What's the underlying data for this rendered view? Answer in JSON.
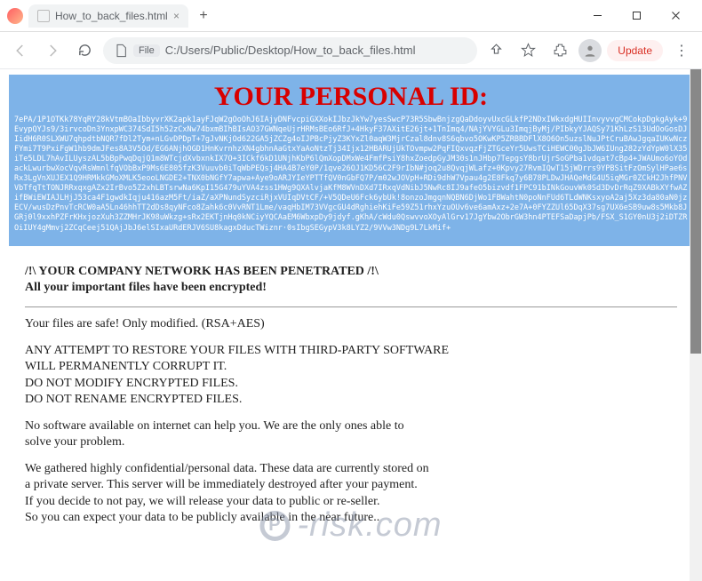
{
  "window": {
    "tab_title": "How_to_back_files.html",
    "new_tab_glyph": "+"
  },
  "toolbar": {
    "file_chip": "File",
    "url": "C:/Users/Public/Desktop/How_to_back_files.html",
    "update_label": "Update"
  },
  "ransom": {
    "heading": "YOUR PERSONAL ID:",
    "id_blob": "7ePA/1P1OTKk78YqRY28kVtmBOaIbbyvrXK2apk1ayFJqW2gOoOhJ6IAjyDNFvcpiGXXokIJbzJkYw7yesSwcP73R5SbwBnjzgQaDdoyvUxcGLkfP2NDxIWkxdgHUIInvyvvgCMCokpDgkgAyk+9EvypQYJs9/3irvcoDn3YnxpWC374SdI5h52zCxNw74bxmBIhBIsAO37GWNqeUjrHRMsBEo6RfJ+4HkyF37AXitE26jt+1TnImq4/NAjYVYGLu3ImqjByMj/PIbkyYJAQSy71KhLzS13UdOoGosDJIidH6R0SLXWU7qhpdtbNQR7fDl2Tym+nLGvDPDpT+7gJvNKjOd622GA5jZCZg4oIJPBcPjyZ3KYxZl0aqW3MjrCzal8dnv8S6qbvo5OKwKP5ZRBBDFlX8O6On5uzslNuJPtCruBAwJgqaIUKwNczFYmi7T9PxiFgW1hb9dmJFes8A3V5Od/EG6ANjhOGD1HnKvrnhzXN4gbhnAaGtxYaAoNtzTj34Ijx12HBARUjUkTOvmpw2PqFIQxvqzFjZTGceYr5UwsTCiHEWC00gJbJW6IUng282zYdYpW0lX35iTe5LDL7hAvILUyszAL5bBpPwqDqjQ1m8WTcjdXvbxnkIX7O+3ICkf6kD1UNjhKbP6lQmXopDMxWe4FmfPsiY8hxZoedpGyJM30s1nJHbp7TepgsY8brUjrSoGPba1vdqat7cBp4+JWAUmo6oYOdackLwurbwXocVqvRsWmnlfqVObBxP9Ms6E805fzK3Vuuvb0iTqWbPEQsj4HA4B7eY0P/1qve26OJ1KD56C2F9rIbN#joq2u8QvqjWLafz+0Kpvy27RvmIQwT15jWDrrs9YPBSitFzOmSylHPae6sRx3LgVnXUJEX1Q9HRMkkGMoXMLK5eooLNGDE2+TNX0bNGfY7apwa+Aye9oARJYIeYPTTfQV0nGbFQ7P/m02wJOVpH+RDi9dhW7Vpau4g2E8Fkq7y6B78PLDwJHAQeMdG4U5iqMGr0ZCkH2JhfPNVVbTfqTtTONJRRxqxgAZx2IrBvo5Z2xhLBTsrwNa6KpI15G479uYVA4zss1HWg9QXAlvjaKfM8WVnDXd7IRxqVdNibJ5NwRc8IJ9afeO5bizvdf1FPC91bINkGouvWk0Sd3DvDrRqZ9XABkXYfwAZifBWiEWIAJLHjJ53ca4F1gwdkIqju416azM5Ft/iaZ/aXPNundSyzciRjxVUIqDVtCF/+V5QDeU6Fck6ybUk!8onzoJmgqnNQBN6DjWo1FBWahtN0poNnFUd6TLdWNKsxyoA2aj5Xz3da80aN0jzECV/wusDzPnvTcRCW0aA5Ln46hhTT2dDs8qyNFco8Zahk6c0VvRNT1Lme/vaqHbIM73VVgcGU4dRghiehKiFe59Z51rhxYzuOUv6ve6amAxz+2e7A+0FYZZUl65DqX37sg7UX6eSB9uw8s5Mkb8JGRj0l9xxhPZFrKHxjozXuh3ZZMHrJK98uWkzg+sRx2EKTjnHq0kNCiyYQCAaEM6WbxpDy9jdyf.gKhA/cWdu0QswvvoXOyAlGrv17JgYbw2ObrGW3hn4PTEFSaDapjPb/FSX_S1GY0nU3j2iDTZROiIUY4gMmvj2ZCqCeej51QAjJbJ6elSIxaURdERJV6SU8kagxDducTWiznr·0sIbgSEGypV3k8LYZ2/9VVw3NDg9L7LkMif+",
    "line1": "/!\\ YOUR COMPANY NETWORK HAS BEEN PENETRATED /!\\",
    "line2": "All your important files have been encrypted!",
    "p1": "Your files are safe! Only modified. (RSA+AES)",
    "p2a": "ANY ATTEMPT TO RESTORE YOUR FILES WITH THIRD-PARTY SOFTWARE",
    "p2b": "WILL PERMANENTLY CORRUPT IT.",
    "p2c": "DO NOT MODIFY ENCRYPTED FILES.",
    "p2d": "DO NOT RENAME ENCRYPTED FILES.",
    "p3a": "No software available on internet can help you. We are the only ones able to",
    "p3b": "solve your problem.",
    "p4a": "We gathered highly confidential/personal data. These data are currently stored on",
    "p4b": "a private server. This server will be immediately destroyed after your payment.",
    "p4c": "If you decide to not pay, we will release your data to public or re-seller.",
    "p4d": "So you can expect your data to be publicly available in the near future.."
  },
  "watermark": {
    "logo_letter": "P",
    "text": "-risk.com"
  }
}
